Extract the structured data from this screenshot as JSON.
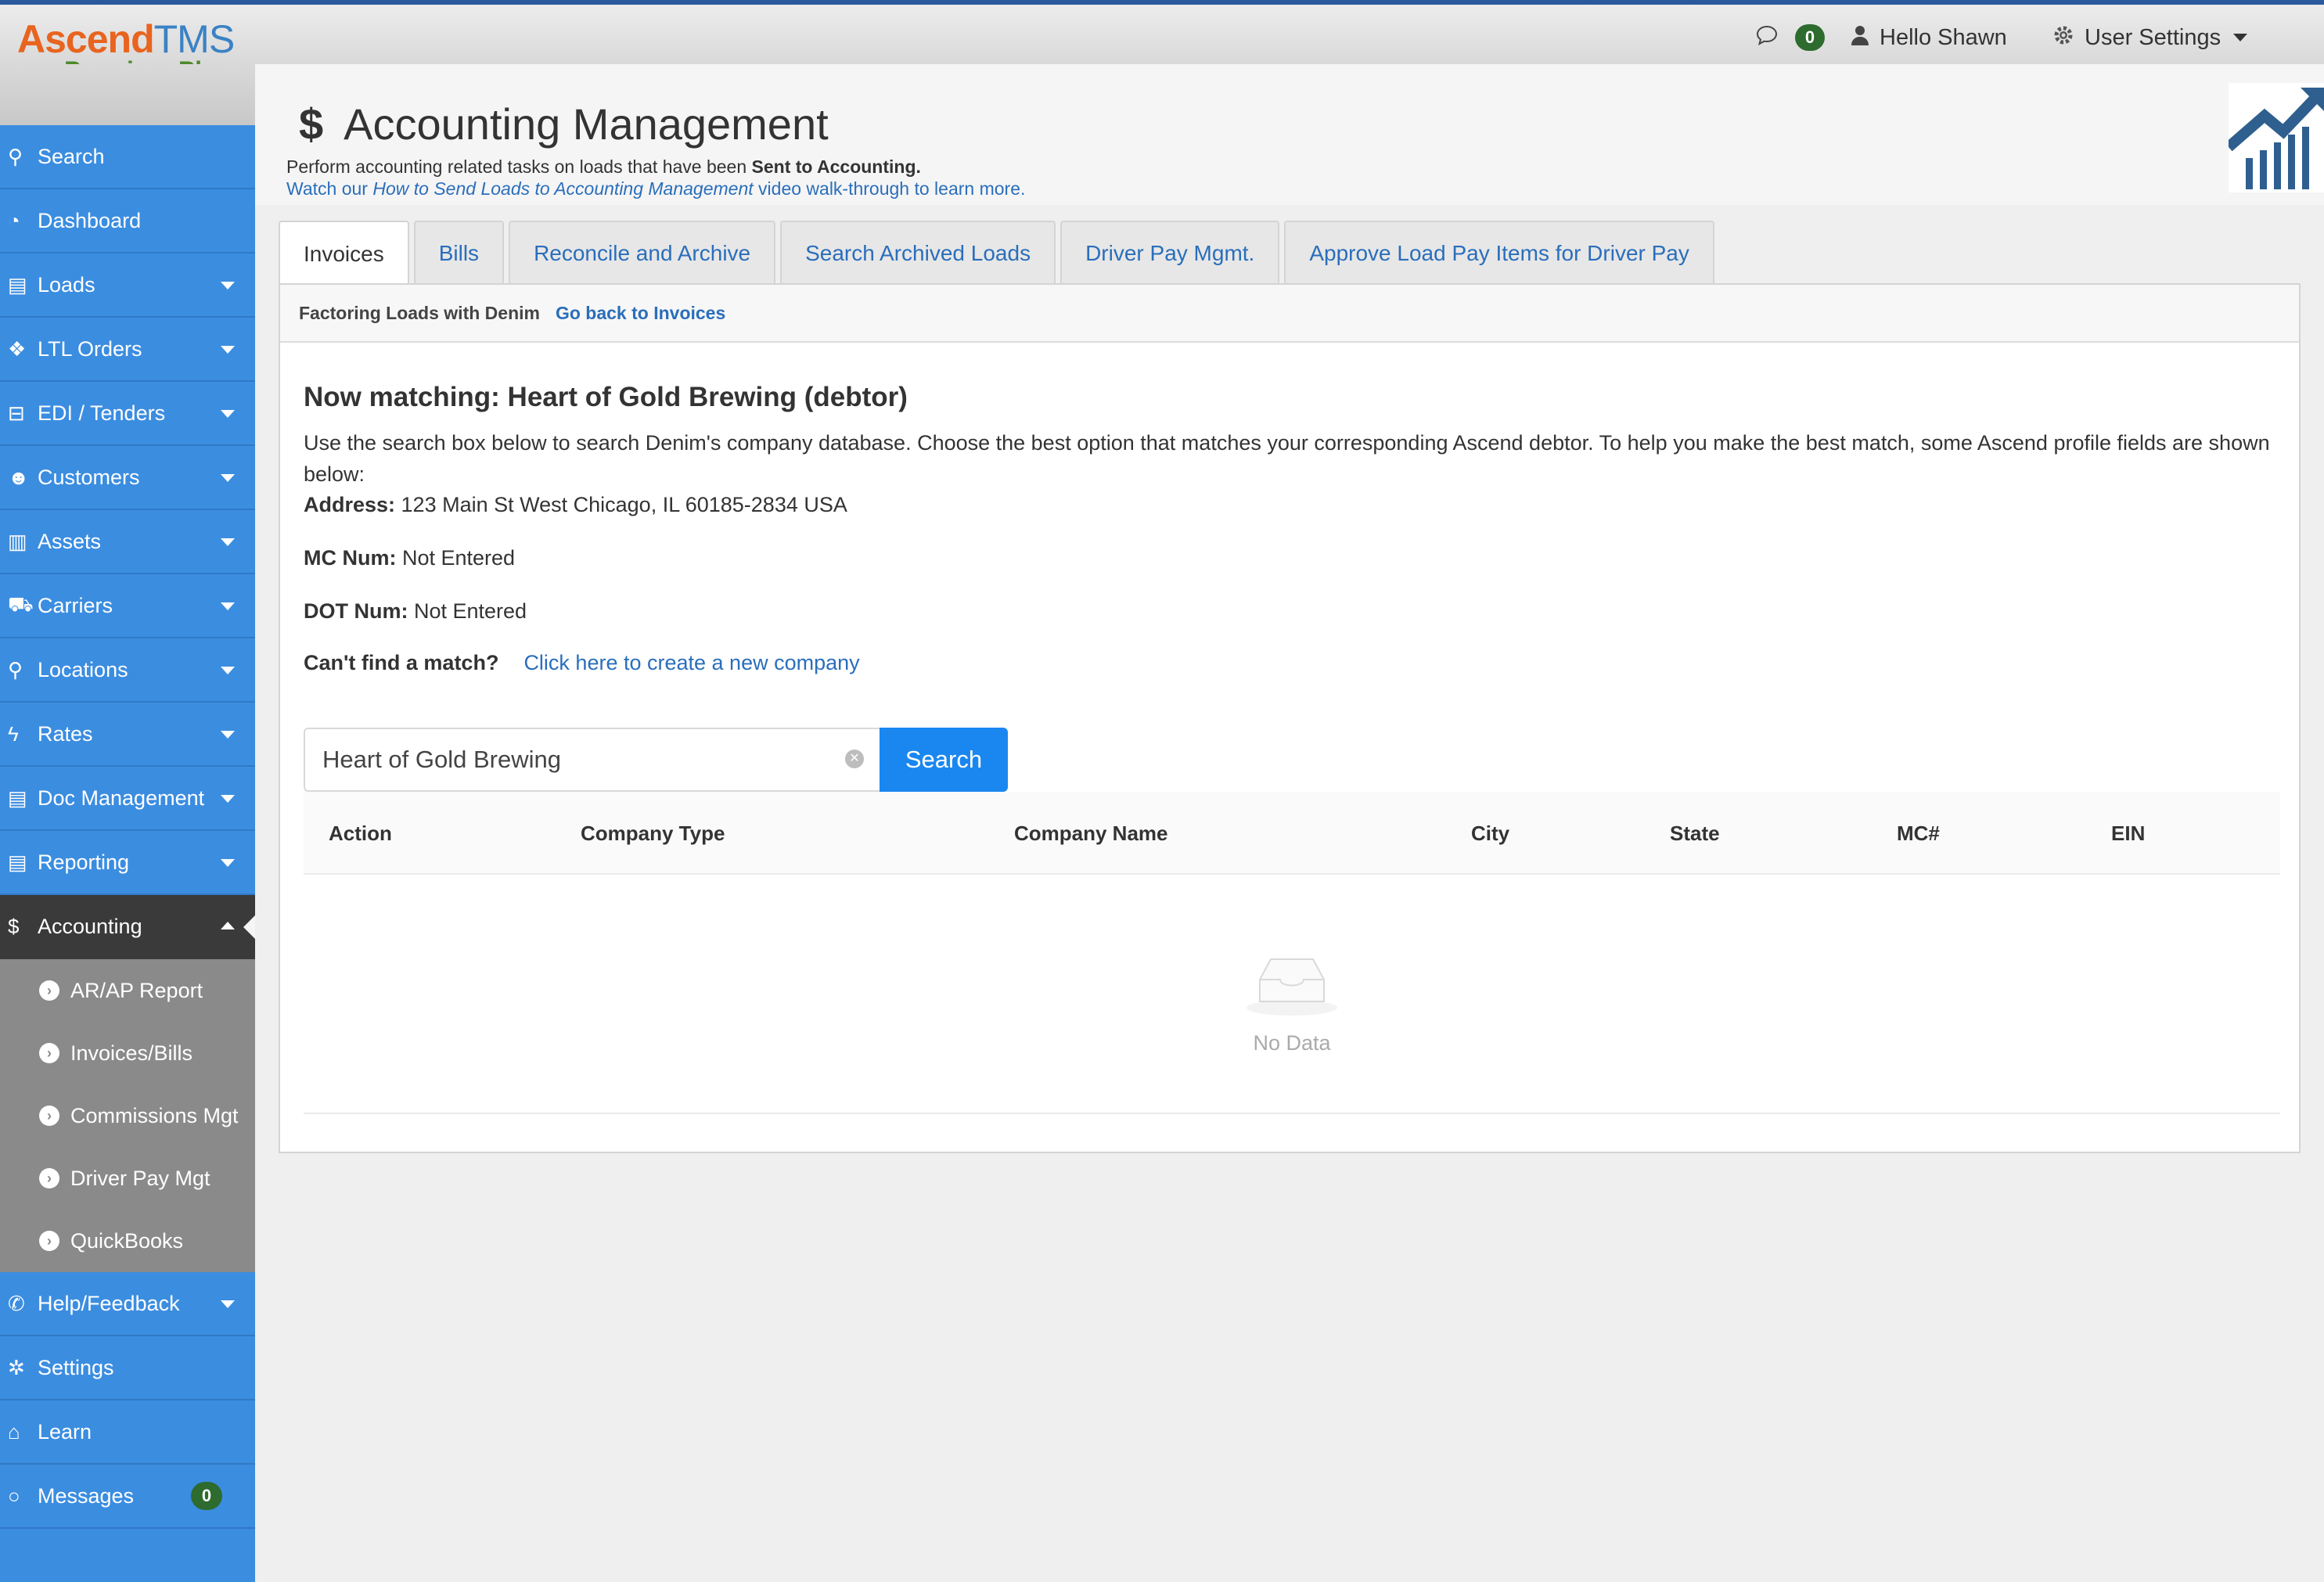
{
  "brand": {
    "name_part1": "Ascend",
    "name_part2": "TMS",
    "plan": "Premium Plan",
    "accent_orange": "#e8641f",
    "accent_blue": "#3a82c4",
    "plan_green": "#4e8a2c"
  },
  "topbar": {
    "messages_count": "0",
    "greeting": "Hello Shawn",
    "settings_label": "User Settings"
  },
  "sidebar": {
    "items": [
      {
        "label": "Search",
        "icon": "search-icon"
      },
      {
        "label": "Dashboard",
        "icon": "dashboard-icon"
      },
      {
        "label": "Loads",
        "icon": "loads-icon"
      },
      {
        "label": "LTL Orders",
        "icon": "ltl-orders-icon"
      },
      {
        "label": "EDI / Tenders",
        "icon": "edi-icon"
      },
      {
        "label": "Customers",
        "icon": "customers-icon"
      },
      {
        "label": "Assets",
        "icon": "assets-icon"
      },
      {
        "label": "Carriers",
        "icon": "truck-icon"
      },
      {
        "label": "Locations",
        "icon": "map-pin-icon"
      },
      {
        "label": "Rates",
        "icon": "bolt-icon"
      },
      {
        "label": "Doc Management",
        "icon": "document-icon"
      },
      {
        "label": "Reporting",
        "icon": "report-icon"
      },
      {
        "label": "Accounting",
        "icon": "dollar-icon"
      }
    ],
    "accounting_sub": [
      {
        "label": "AR/AP Report"
      },
      {
        "label": "Invoices/Bills"
      },
      {
        "label": "Commissions Mgt"
      },
      {
        "label": "Driver Pay Mgt"
      },
      {
        "label": "QuickBooks"
      }
    ],
    "bottom_items": [
      {
        "label": "Help/Feedback",
        "icon": "megaphone-icon"
      },
      {
        "label": "Settings",
        "icon": "gears-icon"
      },
      {
        "label": "Learn",
        "icon": "graduation-cap-icon"
      },
      {
        "label": "Messages",
        "icon": "chat-icon"
      }
    ],
    "messages_count": "0",
    "color": "#3b8de0"
  },
  "page": {
    "title_symbol": "$",
    "title": "Accounting Management",
    "subtitle_prefix": "Perform accounting related tasks on loads that have been ",
    "subtitle_bold": "Sent to Accounting.",
    "video_prefix": "Watch our ",
    "video_title": "How to Send Loads to Accounting Management",
    "video_suffix": " video walk-through to learn more."
  },
  "tabs": [
    {
      "label": "Invoices",
      "active": true
    },
    {
      "label": "Bills",
      "active": false
    },
    {
      "label": "Reconcile and Archive",
      "active": false
    },
    {
      "label": "Search Archived Loads",
      "active": false
    },
    {
      "label": "Driver Pay Mgmt.",
      "active": false
    },
    {
      "label": "Approve Load Pay Items for Driver Pay",
      "active": false
    }
  ],
  "panel": {
    "crumb": "Factoring Loads with Denim",
    "back_link": "Go back to Invoices",
    "match_title": "Now matching: Heart of Gold Brewing (debtor)",
    "description": "Use the search box below to search Denim's company database. Choose the best option that matches your corresponding Ascend debtor. To help you make the best match, some Ascend profile fields are shown below:",
    "address_label": "Address:",
    "address_value": " 123 Main St West Chicago, IL 60185-2834 USA",
    "mc_label": "MC Num:",
    "mc_value": " Not Entered",
    "dot_label": "DOT Num:",
    "dot_value": " Not Entered",
    "cant_find_label": "Can't find a match?",
    "create_link": "Click here to create a new company",
    "search_value": "Heart of Gold Brewing",
    "search_button": "Search",
    "columns": [
      "Action",
      "Company Type",
      "Company Name",
      "City",
      "State",
      "MC#",
      "EIN"
    ],
    "rows": [],
    "empty_text": "No Data",
    "button_color": "#1a87f0"
  }
}
